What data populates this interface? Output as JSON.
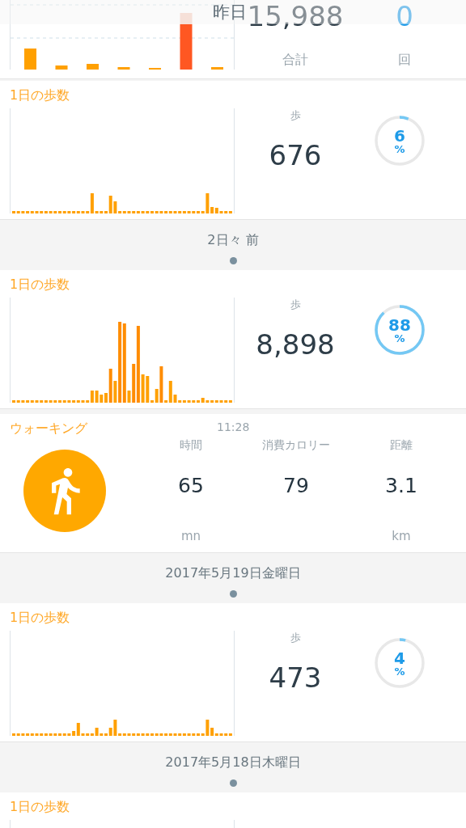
{
  "top_card": {
    "header": "昨日",
    "total": "15,988",
    "total_label": "合計",
    "count": "0",
    "count_label": "回"
  },
  "feed": [
    {
      "kind": "steps",
      "title": "1日の歩数",
      "unit": "歩",
      "value": "676",
      "percent": "6",
      "percent_sign": "%"
    },
    {
      "kind": "date",
      "label": "2日々 前"
    },
    {
      "kind": "steps",
      "title": "1日の歩数",
      "unit": "歩",
      "value": "8,898",
      "percent": "88",
      "percent_sign": "%"
    },
    {
      "kind": "walking",
      "title": "ウォーキング",
      "time": "11:28",
      "stats": [
        {
          "label": "時間",
          "value": "65",
          "unit": "mn"
        },
        {
          "label": "消費カロリー",
          "value": "79"
        },
        {
          "label": "距離",
          "value": "3.1",
          "unit": "km"
        }
      ]
    },
    {
      "kind": "date",
      "label": "2017年5月19日金曜日"
    },
    {
      "kind": "steps",
      "title": "1日の歩数",
      "unit": "歩",
      "value": "473",
      "percent": "4",
      "percent_sign": "%"
    },
    {
      "kind": "date",
      "label": "2017年5月18日木曜日"
    },
    {
      "kind": "steps",
      "title": "1日の歩数"
    }
  ]
}
